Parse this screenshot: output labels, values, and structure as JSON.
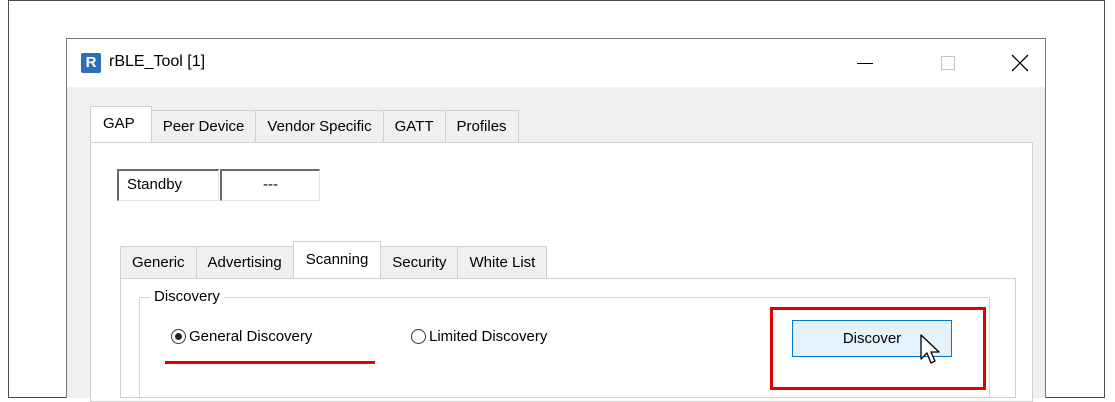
{
  "window": {
    "title": "rBLE_Tool [1]",
    "app_icon_letter": "R",
    "controls": {
      "minimize": "minimize",
      "maximize": "maximize",
      "close": "close"
    }
  },
  "main_tabs": [
    {
      "label": "GAP",
      "active": true
    },
    {
      "label": "Peer Device",
      "active": false
    },
    {
      "label": "Vendor Specific",
      "active": false
    },
    {
      "label": "GATT",
      "active": false
    },
    {
      "label": "Profiles",
      "active": false
    }
  ],
  "status": {
    "state": "Standby",
    "value": "---"
  },
  "sub_tabs": [
    {
      "label": "Generic",
      "active": false
    },
    {
      "label": "Advertising",
      "active": false
    },
    {
      "label": "Scanning",
      "active": true
    },
    {
      "label": "Security",
      "active": false
    },
    {
      "label": "White List",
      "active": false
    }
  ],
  "discovery": {
    "legend": "Discovery",
    "options": [
      {
        "label": "General Discovery",
        "checked": true
      },
      {
        "label": "Limited Discovery",
        "checked": false
      }
    ],
    "button_label": "Discover"
  },
  "annotations": {
    "highlight_color": "#e00000"
  },
  "icons": [
    "app-icon",
    "minimize-icon",
    "maximize-icon",
    "close-icon",
    "mouse-cursor-icon"
  ]
}
